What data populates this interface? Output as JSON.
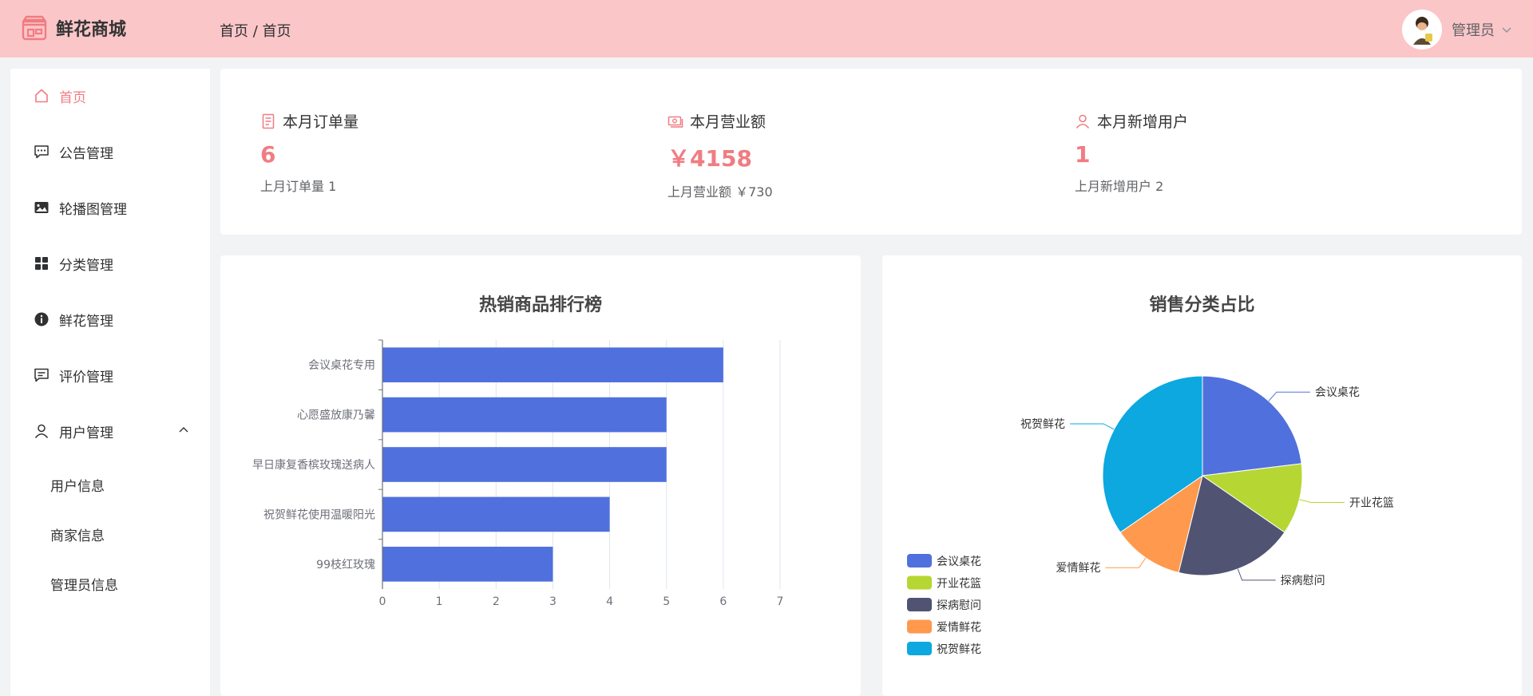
{
  "app": {
    "title": "鲜花商城"
  },
  "breadcrumb": "首页 / 首页",
  "user": {
    "name": "管理员"
  },
  "sidebar": {
    "items": [
      {
        "label": "首页",
        "icon": "home-icon"
      },
      {
        "label": "公告管理",
        "icon": "chat-dots-icon"
      },
      {
        "label": "轮播图管理",
        "icon": "picture-icon"
      },
      {
        "label": "分类管理",
        "icon": "grid-icon"
      },
      {
        "label": "鲜花管理",
        "icon": "info-icon"
      },
      {
        "label": "评价管理",
        "icon": "comment-icon"
      },
      {
        "label": "用户管理",
        "icon": "user-icon"
      }
    ],
    "sub_items": [
      {
        "label": "用户信息"
      },
      {
        "label": "商家信息"
      },
      {
        "label": "管理员信息"
      }
    ]
  },
  "stats": [
    {
      "title": "本月订单量",
      "value": "6",
      "sub": "上月订单量 1"
    },
    {
      "title": "本月营业额",
      "value": "￥4158",
      "sub": "上月营业额 ￥730"
    },
    {
      "title": "本月新增用户",
      "value": "1",
      "sub": "上月新增用户 2"
    }
  ],
  "colors": {
    "accent": "#f07c82",
    "header_bg": "#fbc6c8",
    "bar": "#5070dd"
  },
  "chart_data": [
    {
      "type": "bar",
      "orientation": "horizontal",
      "title": "热销商品排行榜",
      "categories": [
        "会议桌花专用",
        "心愿盛放康乃馨",
        "早日康复香槟玫瑰送病人",
        "祝贺鲜花使用温暖阳光",
        "99枝红玫瑰"
      ],
      "values": [
        6,
        5,
        5,
        4,
        3
      ],
      "xlim": [
        0,
        7
      ],
      "xticks": [
        "0",
        "1",
        "2",
        "3",
        "4",
        "5",
        "6",
        "7"
      ],
      "grid": true
    },
    {
      "type": "pie",
      "title": "销售分类占比",
      "legend_position": "bottom-left",
      "slices": [
        {
          "name": "会议桌花",
          "value": 6,
          "color": "#5070dd"
        },
        {
          "name": "开业花篮",
          "value": 3,
          "color": "#b6d634"
        },
        {
          "name": "探病慰问",
          "value": 5,
          "color": "#505372"
        },
        {
          "name": "爱情鲜花",
          "value": 3,
          "color": "#ff994d"
        },
        {
          "name": "祝贺鲜花",
          "value": 9,
          "color": "#0ca8df"
        }
      ]
    }
  ]
}
